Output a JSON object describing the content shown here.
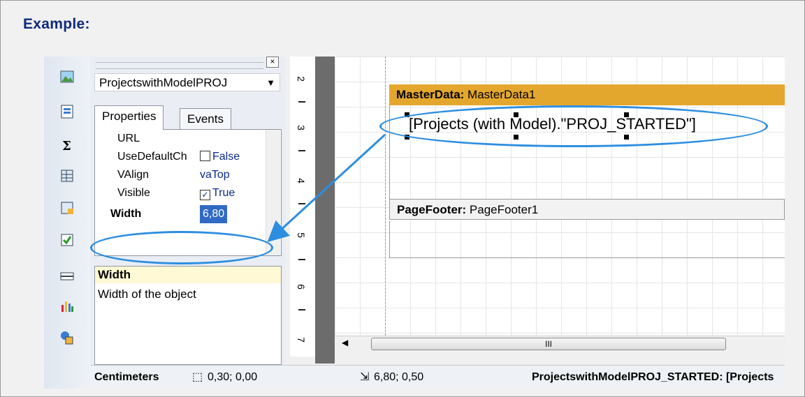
{
  "heading": "Example:",
  "panel": {
    "close_glyph": "×",
    "object_combo": "ProjectswithModelPROJ",
    "tabs": [
      "Properties",
      "Events"
    ],
    "properties": [
      {
        "name": "URL",
        "value": ""
      },
      {
        "name": "UseDefaultCh",
        "value": "False",
        "checkbox": false
      },
      {
        "name": "VAlign",
        "value": "vaTop"
      },
      {
        "name": "Visible",
        "value": "True",
        "checkbox": true
      },
      {
        "name": "Width",
        "value": "6,80"
      }
    ],
    "desc_title": "Width",
    "desc_text": "Width of the object"
  },
  "ruler": {
    "numbers": [
      "2",
      "3",
      "4",
      "5",
      "6",
      "7"
    ]
  },
  "design": {
    "masterdata_label": "MasterData:",
    "masterdata_name": "MasterData1",
    "textobject": "[Projects (with Model).\"PROJ_STARTED\"]",
    "pagefooter_label": "PageFooter:",
    "pagefooter_name": "PageFooter1"
  },
  "scroll_label": "III",
  "status": {
    "units": "Centimeters",
    "position": "0,30; 0,00",
    "size": "6,80; 0,50",
    "object": "ProjectswithModelPROJ_STARTED: [Projects"
  },
  "colors": {
    "accent_circle": "#2d8ee0",
    "band_masterdata": "#e4a72e",
    "heading": "#102a7a"
  }
}
